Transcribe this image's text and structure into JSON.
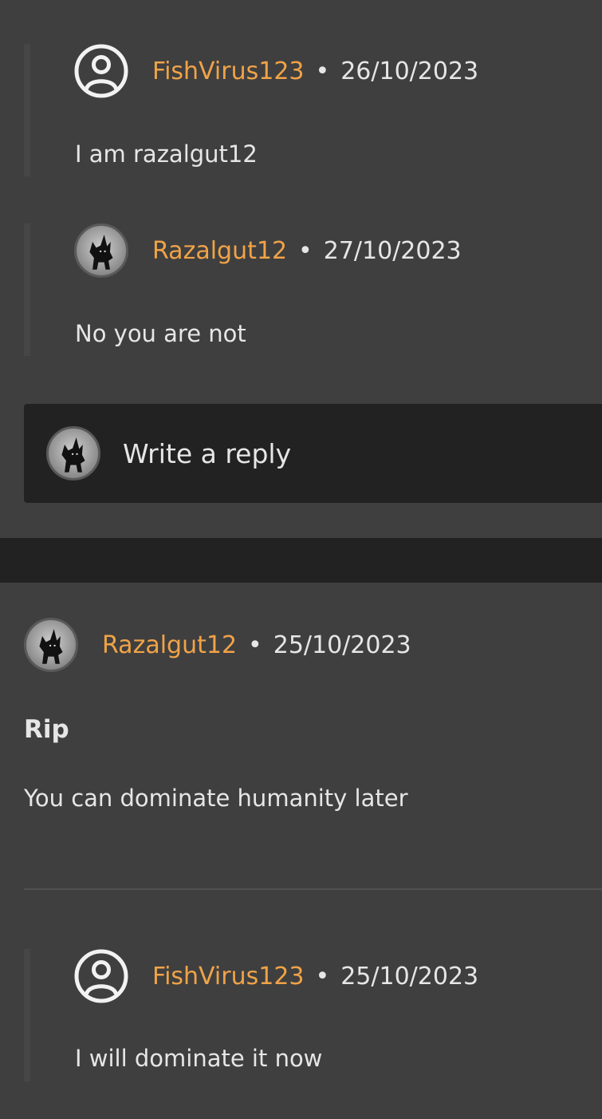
{
  "replies_top": [
    {
      "username": "FishVirus123",
      "date": "26/10/2023",
      "text": "I am razalgut12",
      "avatar": "default-user-icon"
    },
    {
      "username": "Razalgut12",
      "date": "27/10/2023",
      "text": "No you are not",
      "avatar": "black-cat-avatar"
    }
  ],
  "reply_box": {
    "placeholder": "Write a reply",
    "avatar": "black-cat-avatar"
  },
  "post": {
    "username": "Razalgut12",
    "date": "25/10/2023",
    "title": "Rip",
    "body": "You can dominate humanity later",
    "avatar": "black-cat-avatar"
  },
  "post_replies": [
    {
      "username": "FishVirus123",
      "date": "25/10/2023",
      "text": "I will dominate it now",
      "avatar": "default-user-icon"
    }
  ],
  "separator": "•",
  "colors": {
    "background": "#3f3f3f",
    "dark_band": "#222222",
    "username": "#f0a348",
    "text": "#e6e6e6"
  }
}
